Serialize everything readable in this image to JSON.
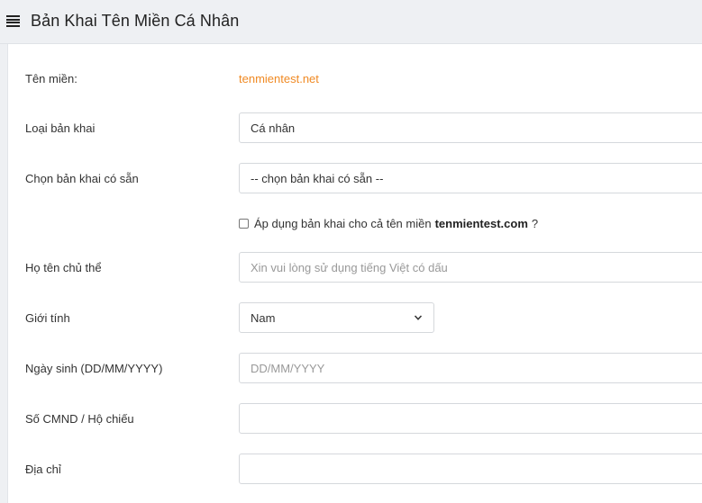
{
  "header": {
    "title": "Bản Khai Tên Miền Cá Nhân",
    "menu_icon": "hamburger-list-icon"
  },
  "form": {
    "domain": {
      "label": "Tên miền:",
      "value": "tenmientest.net"
    },
    "declaration_type": {
      "label": "Loại bản khai",
      "value": "Cá nhân"
    },
    "existing_declaration": {
      "label": "Chọn bản khai có sẵn",
      "value": "-- chọn bản khai có sẵn --"
    },
    "apply_all": {
      "text_before": "Áp dụng bản khai cho cả tên miền",
      "domain": "tenmientest.com",
      "text_after": "?",
      "checked": false
    },
    "full_name": {
      "label": "Họ tên chủ thể",
      "placeholder": "Xin vui lòng sử dụng tiếng Việt có dấu"
    },
    "gender": {
      "label": "Giới tính",
      "value": "Nam"
    },
    "birthdate": {
      "label": "Ngày sinh (DD/MM/YYYY)",
      "placeholder": "DD/MM/YYYY"
    },
    "id_number": {
      "label": "Số CMND / Hộ chiếu",
      "value": ""
    },
    "address": {
      "label": "Địa chỉ",
      "value": ""
    }
  },
  "colors": {
    "accent": "#f08a24",
    "background": "#eef0f3",
    "card": "#ffffff"
  }
}
